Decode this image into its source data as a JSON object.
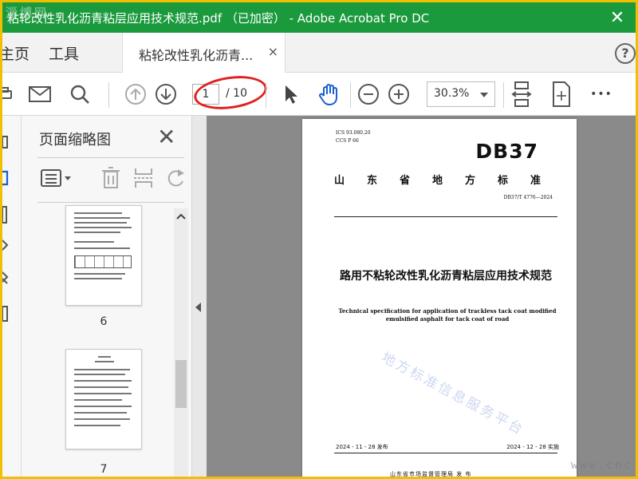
{
  "window": {
    "title": "粘轮改性乳化沥青粘层应用技术规范.pdf （已加密） - Adobe Acrobat Pro DC",
    "close_glyph": "✕",
    "corner_logo": "淄博网"
  },
  "menu": {
    "home_label": "主页",
    "tools_label": "工具",
    "doc_tab_label": "粘轮改性乳化沥青...",
    "doc_tab_close": "×",
    "help_glyph": "?"
  },
  "toolbar": {
    "current_page": "1",
    "total_pages": "/ 10",
    "zoom_value": "30.3%",
    "more_glyph": "•••",
    "annotation_color": "#e02020"
  },
  "thumbnails_panel": {
    "title": "页面缩略图",
    "close_glyph": "✕",
    "thumbs": [
      {
        "page_label": "6"
      },
      {
        "page_label": "7"
      }
    ]
  },
  "document_page": {
    "ics": "ICS  93.080.20",
    "ccs": "CCS  P  66",
    "standard_mark": "DB37",
    "standard_type": "山东省地方标准",
    "standard_number": "DB37/T  4776—2024",
    "chinese_title": "路用不粘轮改性乳化沥青粘层应用技术规范",
    "english_title": "Technical specification for application of trackless tack coat modified emulsified asphalt for tack coat of road",
    "issue_date": "2024 - 11 - 28 发布",
    "implementation_date": "2024 - 12 - 28 实施",
    "issuer": "山东省市场监督管理局    发 布",
    "watermark": "地方标准信息服务平台"
  },
  "site_watermark": "www.cnc",
  "colors": {
    "title_bar": "#1b9a3d",
    "outer_border": "#f0c000",
    "doc_background": "#8a8a8a"
  }
}
